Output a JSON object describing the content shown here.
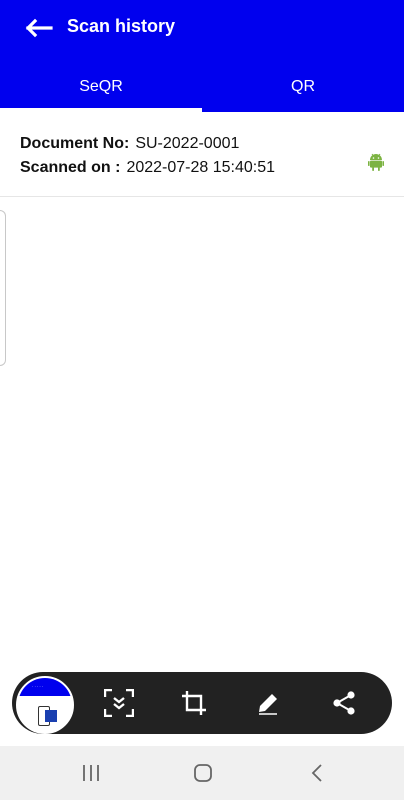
{
  "appbar": {
    "title": "Scan history",
    "back_icon": "arrow-left-icon",
    "color": "#0000ee"
  },
  "tabs": [
    {
      "label": "SeQR",
      "active": true
    },
    {
      "label": "QR",
      "active": false
    }
  ],
  "records": [
    {
      "document_label": "Document No:",
      "document_value": "SU-2022-0001",
      "scanned_label": "Scanned on :",
      "scanned_value": "2022-07-28 15:40:51",
      "platform_icon": "android-icon",
      "platform_color": "#7cb342"
    }
  ],
  "screenshot_toolbar": {
    "icons": [
      "screenshot-thumbnail",
      "scroll-capture-icon",
      "crop-icon",
      "pencil-icon",
      "share-icon"
    ],
    "background": "#222222"
  },
  "system_nav": {
    "icons": [
      "recent-apps-icon",
      "home-icon",
      "back-icon"
    ]
  }
}
